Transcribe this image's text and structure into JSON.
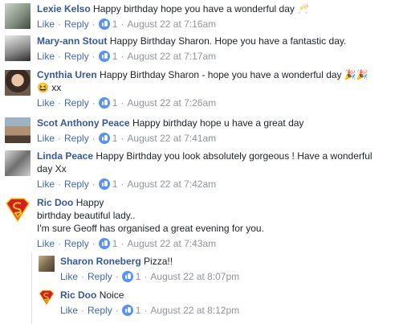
{
  "actions": {
    "like": "Like",
    "reply": "Reply"
  },
  "comments": [
    {
      "name": "Lexie Kelso",
      "text": "Happy birthday hope you have a wonderful day",
      "emoji": "🥂",
      "likes": "1",
      "time": "August 22 at 7:16am"
    },
    {
      "name": "Mary-ann Stout",
      "text": "Happy Birthday Sharon. Hope you have a fantastic day.",
      "likes": "1",
      "time": "August 22 at 7:17am"
    },
    {
      "name": "Cynthia Uren",
      "text": "Happy Birthday Sharon - hope you have a wonderful day",
      "emoji": "🎉🎉",
      "text2": "😆 xx",
      "likes": "1",
      "time": "August 22 at 7:26am"
    },
    {
      "name": "Scot Anthony Peace",
      "text": "Happy birthday hope u have a great day",
      "likes": "1",
      "time": "August 22 at 7:41am"
    },
    {
      "name": "Linda Peace",
      "text": "Happy Birthday you look absolutely gorgeous ! Have a wonderful",
      "text2": "day Xx",
      "likes": "1",
      "time": "August 22 at 7:42am"
    },
    {
      "name": "Ric Doo",
      "text": "Happy",
      "text2": "birthday beautiful lady..",
      "text3": "I'm sure Geoff has organised a great evening for you.",
      "likes": "1",
      "time": "August 22 at 7:43am"
    }
  ],
  "replies": [
    {
      "name": "Sharon Roneberg",
      "text": "Pizza!!",
      "likes": "1",
      "time": "August 22 at 8:07pm"
    },
    {
      "name": "Ric Doo",
      "text": "Noice",
      "likes": "1",
      "time": "August 22 at 8:12pm"
    }
  ],
  "colors": {
    "name": "#365899",
    "link": "#4267b2",
    "meta": "#90949c",
    "like_badge": "#5890ff"
  }
}
